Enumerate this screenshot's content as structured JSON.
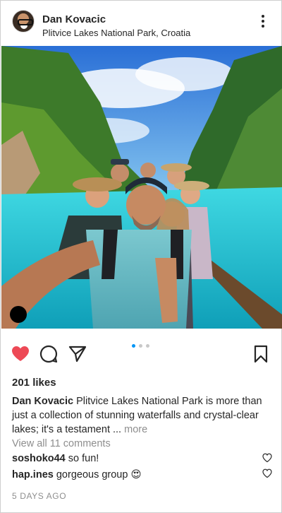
{
  "post": {
    "user": {
      "name": "Dan Kovacic",
      "location": "Plitvice Lakes National Park, Croatia"
    },
    "likes": "201 likes",
    "caption": {
      "author": "Dan Kovacic",
      "text": "Plitvice Lakes National Park is more than just a collection of stunning waterfalls and crystal-clear lakes; it's a testament ... ",
      "more_label": "more"
    },
    "view_comments_label": "View all 11 comments",
    "comments": [
      {
        "user": "soshoko44",
        "text": "so fun!"
      },
      {
        "user": "hap.ines",
        "text": "gorgeous group 😍"
      }
    ],
    "timestamp": "5 DAYS AGO",
    "carousel": {
      "count": 3,
      "active": 1
    },
    "liked": true
  },
  "icons": {
    "like": "heart-icon",
    "comment": "comment-icon",
    "share": "paper-plane-icon",
    "save": "bookmark-icon",
    "more": "more-vertical-icon"
  },
  "colors": {
    "like_red": "#ed4956",
    "accent_blue": "#0095f6",
    "muted_text": "#8e8e8e"
  }
}
